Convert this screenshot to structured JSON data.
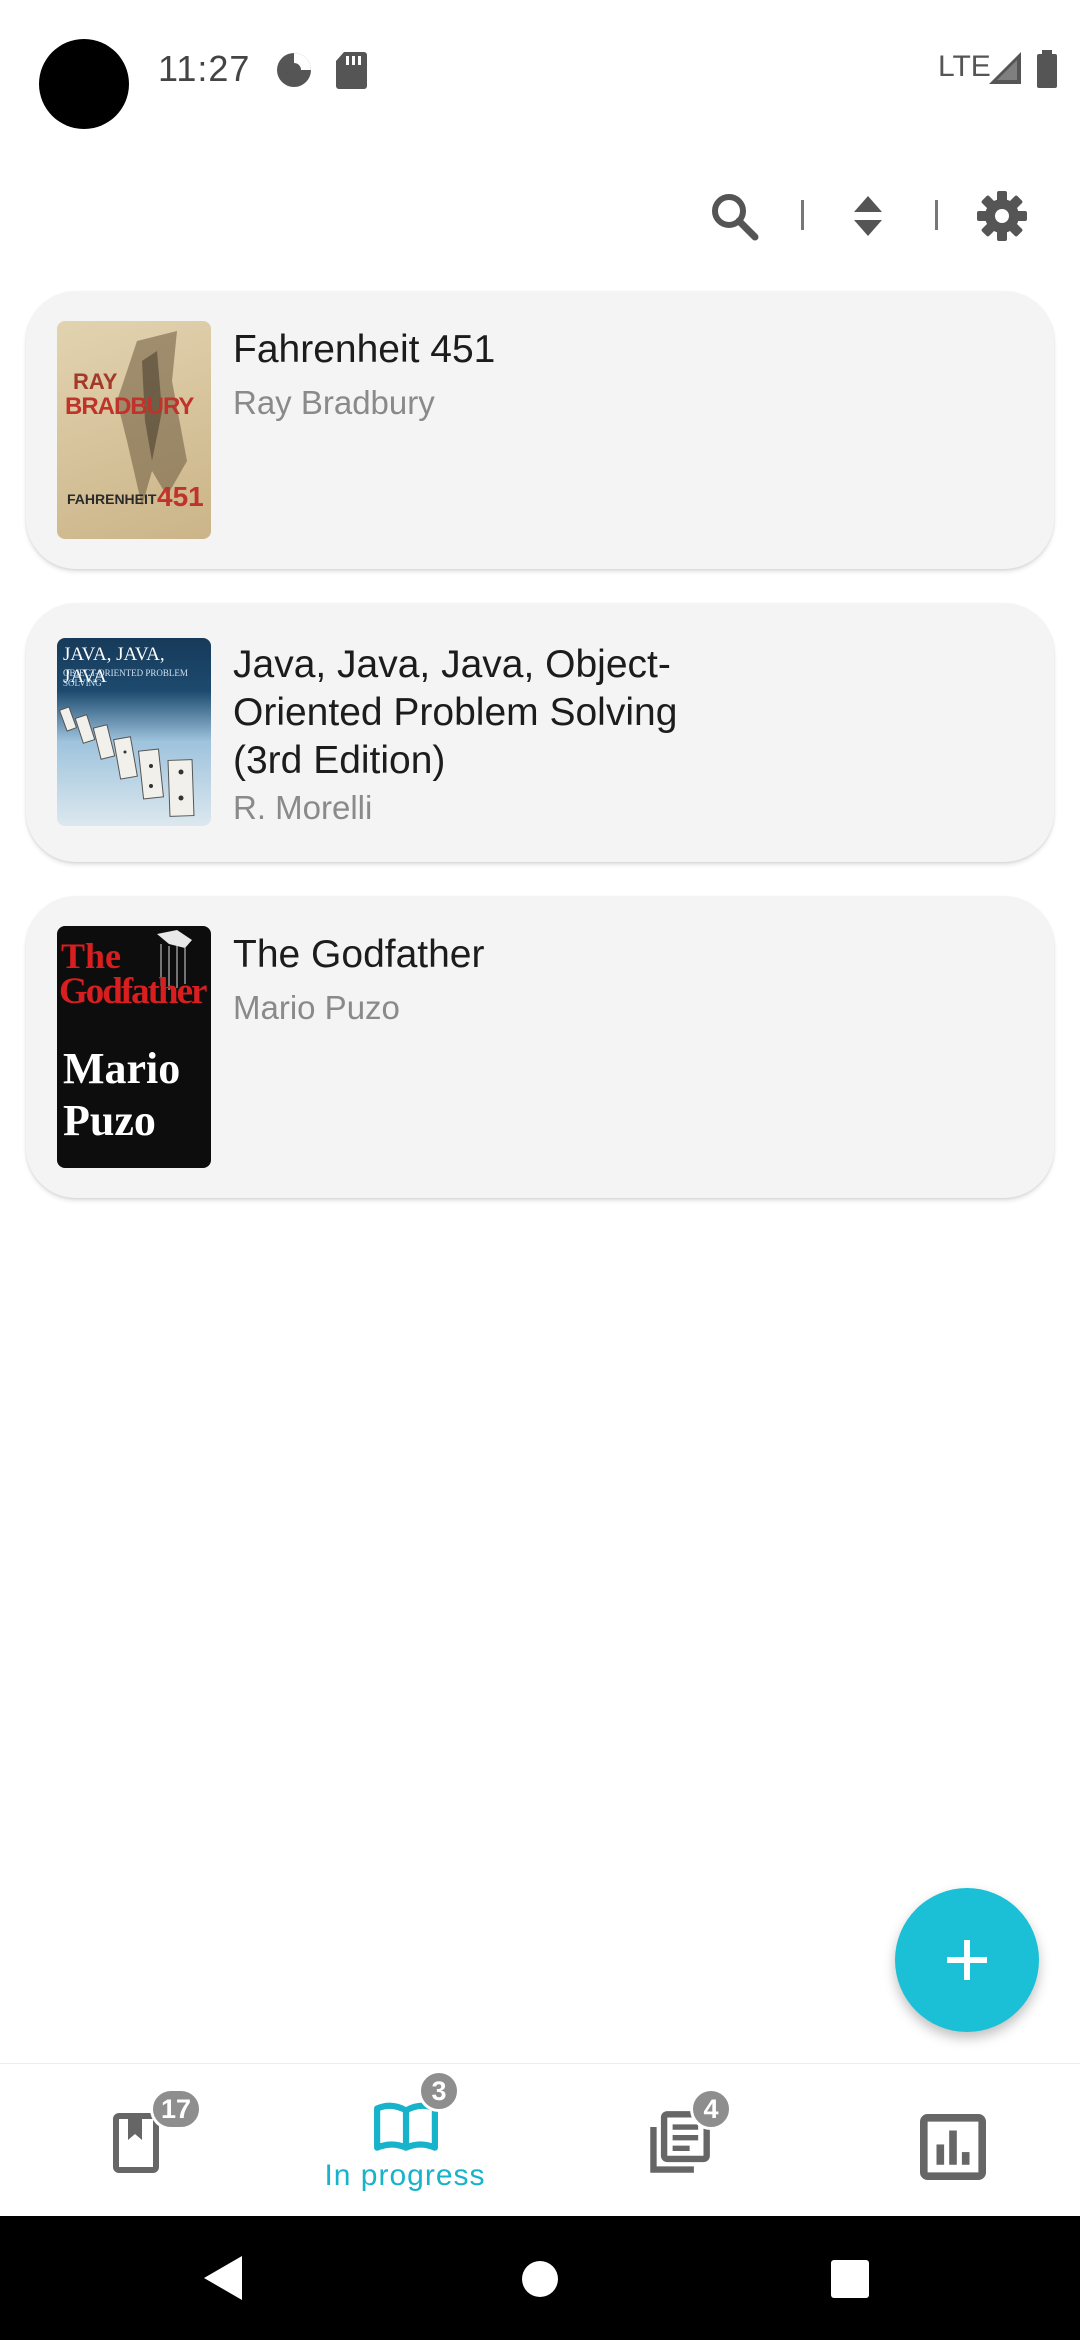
{
  "status_bar": {
    "time": "11:27",
    "network": "LTE",
    "icons": [
      "data-saver-icon",
      "sd-card-icon",
      "signal-icon",
      "battery-icon"
    ]
  },
  "toolbar": {
    "icons": [
      "search-icon",
      "sort-icon",
      "gear-icon"
    ]
  },
  "books": [
    {
      "title": "Fahrenheit 451",
      "author": "Ray Bradbury",
      "cover_text": [
        "RAY",
        "BRADBURY",
        "FAHRENHEIT",
        "451"
      ]
    },
    {
      "title": "Java, Java, Java, Object-Oriented Problem Solving (3rd Edition)",
      "author": "R. Morelli",
      "cover_text": [
        "JAVA, JAVA, JAVA",
        "OBJECT-ORIENTED PROBLEM SOLVING"
      ]
    },
    {
      "title": "The Godfather",
      "author": "Mario Puzo",
      "cover_text": [
        "The",
        "Godfather",
        "Mario",
        "Puzo"
      ]
    }
  ],
  "fab": {
    "icon": "plus-icon"
  },
  "bottom_nav": {
    "items": [
      {
        "icon": "bookmark-book-icon",
        "badge": "17",
        "label": "",
        "active": false
      },
      {
        "icon": "open-book-icon",
        "badge": "3",
        "label": "In progress",
        "active": true
      },
      {
        "icon": "library-list-icon",
        "badge": "4",
        "label": "",
        "active": false
      },
      {
        "icon": "bar-chart-icon",
        "badge": "",
        "label": "",
        "active": false
      }
    ]
  },
  "colors": {
    "accent": "#1bbfd6",
    "card_bg": "#f4f4f4",
    "badge_bg": "#8e8e8e",
    "text_primary": "#1c1c1c",
    "text_secondary": "#8a8a8a"
  }
}
